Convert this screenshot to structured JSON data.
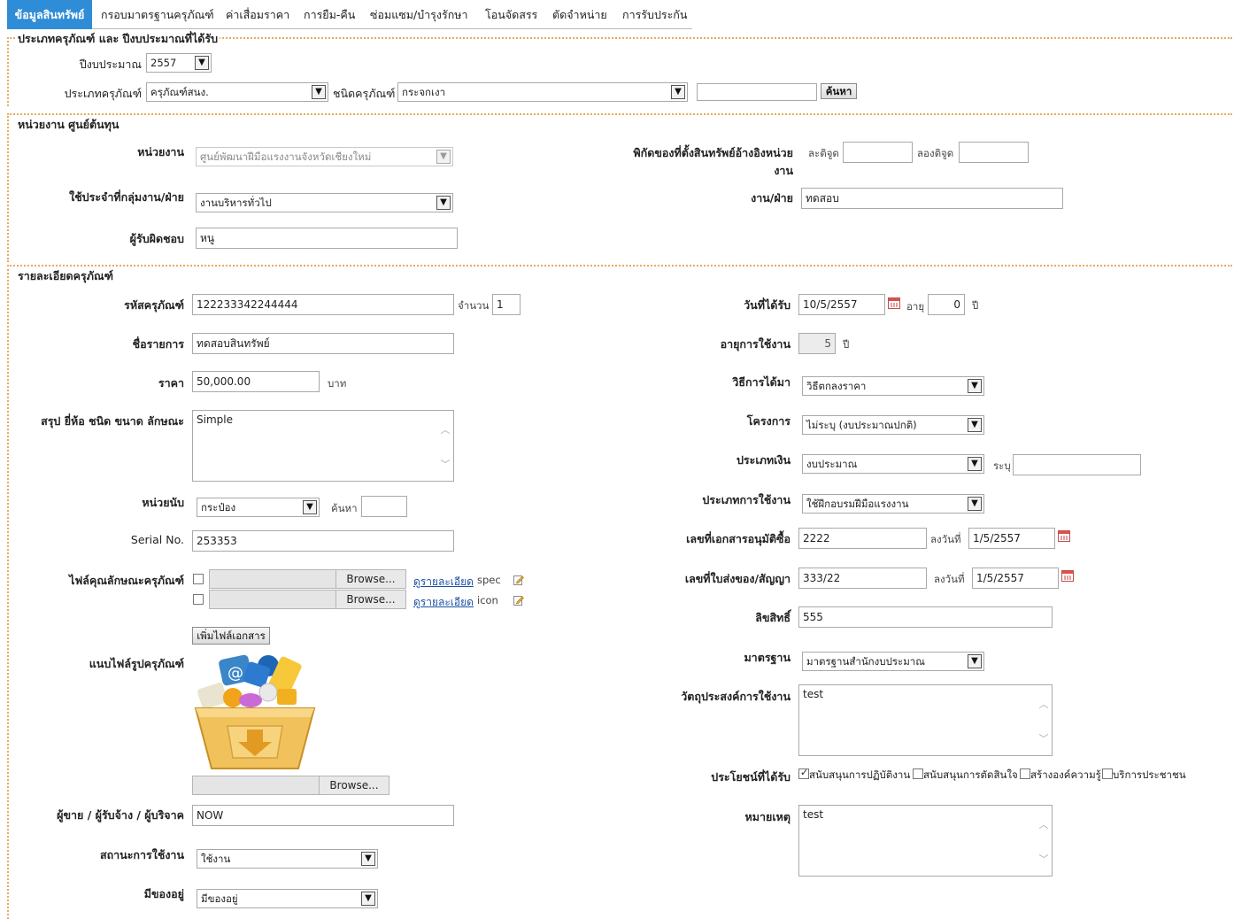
{
  "tabs": [
    {
      "label": "ข้อมูลสินทรัพย์",
      "active": true
    },
    {
      "label": "กรอบมาตรฐานครุภัณฑ์"
    },
    {
      "label": "ค่าเสื่อมราคา"
    },
    {
      "label": "การยืม-คืน"
    },
    {
      "label": "ซ่อมแซม/บำรุงรักษา"
    },
    {
      "label": "โอนจัดสรร"
    },
    {
      "label": "ตัดจำหน่าย"
    },
    {
      "label": "การรับประกัน"
    }
  ],
  "section1": {
    "legend": "ประเภทครุภัณฑ์ และ ปีงบประมาณที่ได้รับ",
    "budget_year_label": "ปีงบประมาณ",
    "budget_year_value": "2557",
    "asset_type_label": "ประเภทครุภัณฑ์",
    "asset_type_value": "ครุภัณฑ์สนง.",
    "asset_kind_label": "ชนิดครุภัณฑ์",
    "asset_kind_value": "กระจกเงา",
    "search_value": "",
    "search_button": "ค้นหา"
  },
  "section2": {
    "legend": "หน่วยงาน ศูนย์ต้นทุน",
    "unit_label": "หน่วยงาน",
    "unit_value": "ศูนย์พัฒนาฝีมือแรงงานจังหวัดเชียงใหม่",
    "dept_label": "ใช้ประจำที่กลุ่มงาน/ฝ่าย",
    "dept_value": "งานบริหารทั่วไป",
    "responsible_label": "ผู้รับผิดชอบ",
    "responsible_value": "หนู",
    "coords_label_line1": "พิกัดของที่ตั้งสินทรัพย์อ้างอิงหน่วย",
    "coords_label_line2": "งาน",
    "lat_label": "ละติจูด",
    "lat_value": "",
    "lng_label": "ลองติจูด",
    "lng_value": "",
    "work_label": "งาน/ฝ่าย",
    "work_value": "ทดสอบ"
  },
  "section3": {
    "legend": "รายละเอียดครุภัณฑ์",
    "code_label": "รหัสครุภัณฑ์",
    "code_value": "122233342244444",
    "qty_label": "จำนวน",
    "qty_value": "1",
    "name_label": "ชื่อรายการ",
    "name_value": "ทดสอบสินทรัพย์",
    "price_label": "ราคา",
    "price_value": "50,000.00",
    "price_unit": "บาท",
    "summary_label": "สรุป ยี่ห้อ ชนิด ขนาด ลักษณะ",
    "summary_value": "Simple",
    "unit_count_label": "หน่วยนับ",
    "unit_count_value": "กระป๋อง",
    "unit_search_label": "ค้นหา",
    "unit_search_value": "",
    "serial_label": "Serial No.",
    "serial_value": "253353",
    "spec_file_label": "ไฟล์คุณลักษณะครุภัณฑ์",
    "browse_label": "Browse...",
    "view_detail_label": "ดูรายละเอียด",
    "spec_tag": "spec",
    "icon_tag": "icon",
    "add_doc_button": "เพิ่มไฟล์เอกสาร",
    "image_label": "แนบไฟล์รูปครุภัณฑ์",
    "vendor_label": "ผู้ขาย / ผู้รับจ้าง / ผู้บริจาค",
    "vendor_value": "NOW",
    "status_label": "สถานะการใช้งาน",
    "status_value": "ใช้งาน",
    "exists_label": "มีของอยู่",
    "exists_value": "มีของอยู่",
    "received_label": "วันที่ได้รับ",
    "received_value": "10/5/2557",
    "age_label": "อายุ",
    "age_value": "0",
    "year_unit": "ปี",
    "life_label": "อายุการใช้งาน",
    "life_value": "5",
    "method_label": "วิธีการได้มา",
    "method_value": "วิธีตกลงราคา",
    "project_label": "โครงการ",
    "project_value": "ไม่ระบุ (งบประมาณปกติ)",
    "money_type_label": "ประเภทเงิน",
    "money_type_value": "งบประมาณ",
    "specify_label": "ระบุ",
    "specify_value": "",
    "usage_type_label": "ประเภทการใช้งาน",
    "usage_type_value": "ใช้ฝึกอบรมฝีมือแรงงาน",
    "approval_no_label": "เลขที่เอกสารอนุมัติซื้อ",
    "approval_no_value": "2222",
    "dated_label": "ลงวันที่",
    "approval_date_value": "1/5/2557",
    "delivery_no_label": "เลขที่ใบส่งของ/สัญญา",
    "delivery_no_value": "333/22",
    "delivery_date_value": "1/5/2557",
    "rights_label": "ลิขสิทธิ์",
    "rights_value": "555",
    "standard_label": "มาตรฐาน",
    "standard_value": "มาตรฐานสำนักงบประมาณ",
    "purpose_label": "วัตถุประสงค์การใช้งาน",
    "purpose_value": "test",
    "benefit_label": "ประโยชน์ที่ได้รับ",
    "benefits": [
      {
        "label": "สนับสนุนการปฏิบัติงาน",
        "checked": true
      },
      {
        "label": "สนับสนุนการตัดสินใจ",
        "checked": false
      },
      {
        "label": "สร้างองค์ความรู้",
        "checked": false
      },
      {
        "label": "บริการประชาชน",
        "checked": false
      }
    ],
    "note_label": "หมายเหตุ",
    "note_value": "test"
  }
}
